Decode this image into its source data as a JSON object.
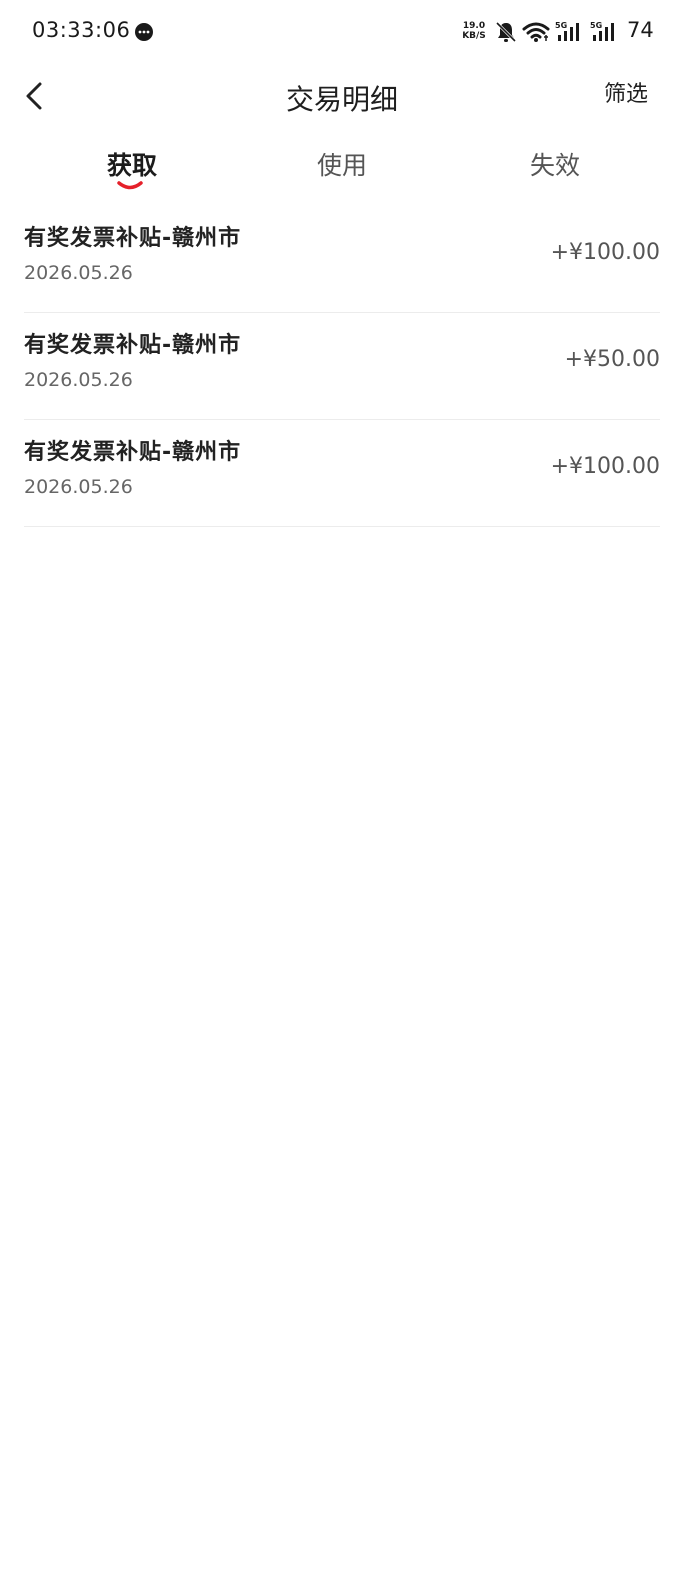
{
  "status_bar": {
    "time": "03:33:06",
    "net_speed_value": "19.0",
    "net_speed_unit": "KB/S",
    "battery": "74",
    "icons": [
      "message-icon",
      "bell-muted-icon",
      "wifi-icon",
      "signal-5g-icon",
      "signal-5g-icon"
    ]
  },
  "header": {
    "title": "交易明细",
    "filter_label": "筛选",
    "back_icon": "chevron-left-icon"
  },
  "tabs": [
    {
      "label": "获取",
      "active": true
    },
    {
      "label": "使用",
      "active": false
    },
    {
      "label": "失效",
      "active": false
    }
  ],
  "accent_color": "#e5202a",
  "transactions": [
    {
      "title": "有奖发票补贴-赣州市",
      "date": "2026.05.26",
      "amount": "+¥100.00"
    },
    {
      "title": "有奖发票补贴-赣州市",
      "date": "2026.05.26",
      "amount": "+¥50.00"
    },
    {
      "title": "有奖发票补贴-赣州市",
      "date": "2026.05.26",
      "amount": "+¥100.00"
    }
  ]
}
